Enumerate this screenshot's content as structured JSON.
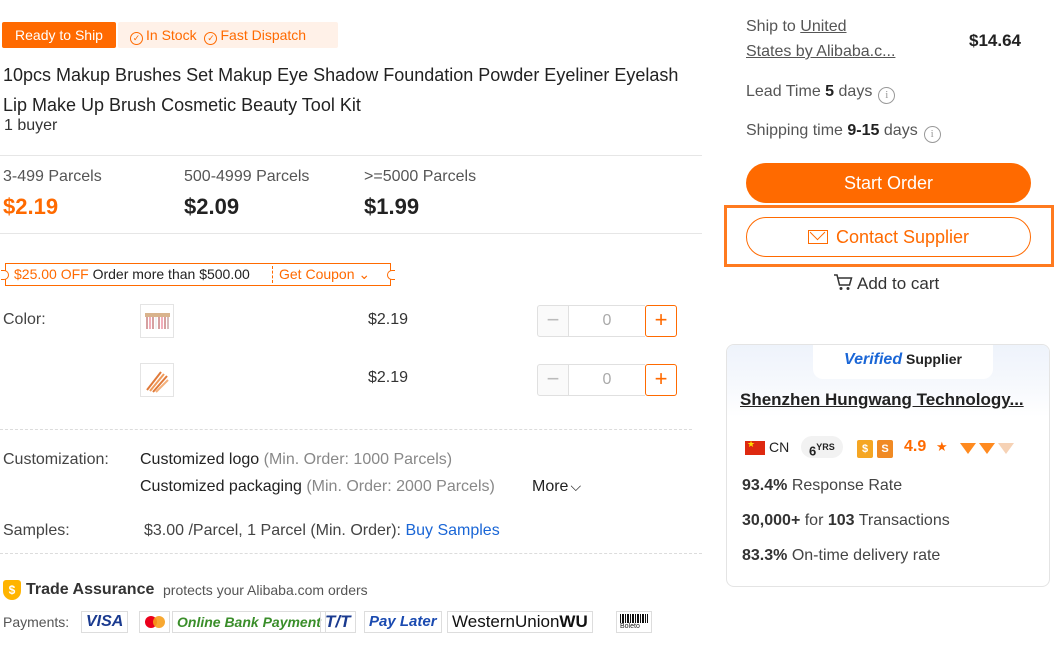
{
  "badges": {
    "ready": "Ready to Ship",
    "in_stock": "In Stock",
    "fast_dispatch": "Fast Dispatch"
  },
  "product": {
    "title": "10pcs Makup Brushes Set Makup Eye Shadow Foundation Powder Eyeliner Eyelash Lip Make Up Brush Cosmetic Beauty Tool Kit",
    "buyers": "1 buyer"
  },
  "tiers": [
    {
      "label": "3-499 Parcels",
      "price": "$2.19"
    },
    {
      "label": "500-4999 Parcels",
      "price": "$2.09"
    },
    {
      "label": ">=5000 Parcels",
      "price": "$1.99"
    }
  ],
  "coupon": {
    "off": "$25.00 OFF",
    "condition": "Order more than $500.00",
    "get": "Get Coupon"
  },
  "color": {
    "label": "Color:",
    "options": [
      {
        "price": "$2.19",
        "qty": "0"
      },
      {
        "price": "$2.19",
        "qty": "0"
      }
    ]
  },
  "customization": {
    "label": "Customization:",
    "items": [
      {
        "name": "Customized logo",
        "min": "(Min. Order: 1000 Parcels)"
      },
      {
        "name": "Customized packaging",
        "min": "(Min. Order: 2000 Parcels)"
      }
    ],
    "more": "More"
  },
  "samples": {
    "label": "Samples:",
    "text": "$3.00 /Parcel, 1 Parcel (Min. Order):",
    "link": "Buy Samples"
  },
  "trade_assurance": {
    "title": "Trade Assurance",
    "subtitle": "protects your Alibaba.com orders"
  },
  "payments": {
    "label": "Payments:",
    "methods": [
      "VISA",
      "Online Bank Payment",
      "T/T",
      "Pay Later",
      "WesternUnion",
      "WU",
      "Boleto"
    ]
  },
  "shipping": {
    "ship_to_prefix": "Ship to",
    "ship_to_line1": "United",
    "ship_to_line2": "States by Alibaba.c...",
    "price": "$14.64",
    "lead_label": "Lead Time",
    "lead_value": "5",
    "lead_unit": "days",
    "ship_time_label": "Shipping time",
    "ship_time_value": "9-15",
    "ship_time_unit": "days"
  },
  "actions": {
    "start_order": "Start Order",
    "contact": "Contact Supplier",
    "add_to_cart": "Add to cart"
  },
  "supplier": {
    "verified": "Verified",
    "verified_suffix": "Supplier",
    "company": "Shenzhen Hungwang Technology...",
    "country": "CN",
    "years": "6",
    "years_unit": "YRS",
    "rating": "4.9",
    "response_value": "93.4%",
    "response_label": "Response Rate",
    "transactions_value": "30,000+",
    "transactions_for": "for",
    "transactions_count": "103",
    "transactions_label": "Transactions",
    "ontime_value": "83.3%",
    "ontime_label": "On-time delivery rate"
  },
  "colors": {
    "accent": "#ff6a00",
    "link": "#1a66d6"
  }
}
